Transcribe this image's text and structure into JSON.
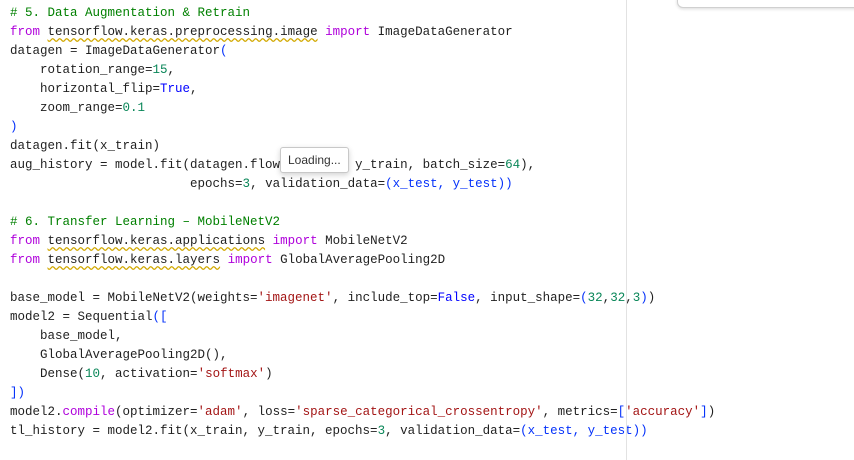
{
  "code_lines": [
    [
      {
        "t": "# 5. Data Augmentation & Retrain",
        "c": "cmt"
      }
    ],
    [
      {
        "t": "from",
        "c": "kw"
      },
      {
        "t": " "
      },
      {
        "t": "tensorflow.keras.preprocessing.image",
        "c": "mod"
      },
      {
        "t": " "
      },
      {
        "t": "import",
        "c": "kw"
      },
      {
        "t": " ImageDataGenerator"
      }
    ],
    [
      {
        "t": "datagen = ImageDataGenerator"
      },
      {
        "t": "(",
        "c": "br"
      }
    ],
    [
      {
        "t": "    rotation_range="
      },
      {
        "t": "15",
        "c": "num"
      },
      {
        "t": ","
      }
    ],
    [
      {
        "t": "    horizontal_flip="
      },
      {
        "t": "True",
        "c": "const"
      },
      {
        "t": ","
      }
    ],
    [
      {
        "t": "    zoom_range="
      },
      {
        "t": "0.1",
        "c": "num"
      }
    ],
    [
      {
        "t": ")",
        "c": "br"
      }
    ],
    [
      {
        "t": "datagen.fit(x_train)"
      }
    ],
    [
      {
        "t": "aug_history = model.fit(datagen.flow(x_train, y_train, batch_size="
      },
      {
        "t": "64",
        "c": "num"
      },
      {
        "t": "),"
      }
    ],
    [
      {
        "t": "                        epochs="
      },
      {
        "t": "3",
        "c": "num"
      },
      {
        "t": ", validation_data="
      },
      {
        "t": "(x_test, y_test)",
        "c": "br"
      },
      {
        "t": ")",
        "c": "br"
      }
    ],
    [],
    [
      {
        "t": "# 6. Transfer Learning – MobileNetV2",
        "c": "cmt"
      }
    ],
    [
      {
        "t": "from",
        "c": "kw"
      },
      {
        "t": " "
      },
      {
        "t": "tensorflow.keras.applications",
        "c": "mod"
      },
      {
        "t": " "
      },
      {
        "t": "import",
        "c": "kw"
      },
      {
        "t": " MobileNetV2"
      }
    ],
    [
      {
        "t": "from",
        "c": "kw"
      },
      {
        "t": " "
      },
      {
        "t": "tensorflow.keras.layers",
        "c": "mod"
      },
      {
        "t": " "
      },
      {
        "t": "import",
        "c": "kw"
      },
      {
        "t": " GlobalAveragePooling2D"
      }
    ],
    [],
    [
      {
        "t": "base_model = MobileNetV2(weights="
      },
      {
        "t": "'imagenet'",
        "c": "str"
      },
      {
        "t": ", include_top="
      },
      {
        "t": "False",
        "c": "const"
      },
      {
        "t": ", input_shape="
      },
      {
        "t": "(",
        "c": "br"
      },
      {
        "t": "32",
        "c": "num"
      },
      {
        "t": ","
      },
      {
        "t": "32",
        "c": "num"
      },
      {
        "t": ","
      },
      {
        "t": "3",
        "c": "num"
      },
      {
        "t": ")",
        "c": "br"
      },
      {
        "t": ")"
      }
    ],
    [
      {
        "t": "model2 = Sequential"
      },
      {
        "t": "([",
        "c": "br"
      }
    ],
    [
      {
        "t": "    base_model,"
      }
    ],
    [
      {
        "t": "    GlobalAveragePooling2D(),"
      }
    ],
    [
      {
        "t": "    Dense("
      },
      {
        "t": "10",
        "c": "num"
      },
      {
        "t": ", activation="
      },
      {
        "t": "'softmax'",
        "c": "str"
      },
      {
        "t": ")"
      }
    ],
    [
      {
        "t": "])",
        "c": "br"
      }
    ],
    [
      {
        "t": "model2."
      },
      {
        "t": "compile",
        "c": "kw"
      },
      {
        "t": "(optimizer="
      },
      {
        "t": "'adam'",
        "c": "str"
      },
      {
        "t": ", loss="
      },
      {
        "t": "'sparse_categorical_crossentropy'",
        "c": "str"
      },
      {
        "t": ", metrics="
      },
      {
        "t": "[",
        "c": "br"
      },
      {
        "t": "'accuracy'",
        "c": "str"
      },
      {
        "t": "]",
        "c": "br"
      },
      {
        "t": ")"
      }
    ],
    [
      {
        "t": "tl_history = model2.fit(x_train, y_train, epochs="
      },
      {
        "t": "3",
        "c": "num"
      },
      {
        "t": ", validation_data="
      },
      {
        "t": "(x_test, y_test)",
        "c": "br"
      },
      {
        "t": ")",
        "c": "br"
      }
    ]
  ],
  "tooltip": {
    "text": "Loading..."
  },
  "colors": {
    "comment": "#008000",
    "keyword": "#af00db",
    "number": "#098658",
    "string": "#a31515",
    "constant": "#0000ff",
    "bracket": "#0431fa"
  }
}
